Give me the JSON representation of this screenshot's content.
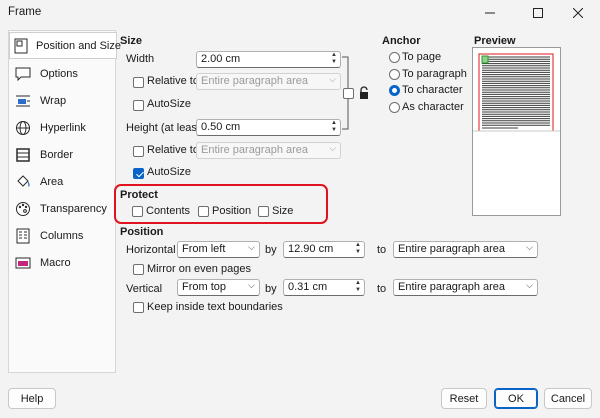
{
  "window": {
    "title": "Frame"
  },
  "sidebar": {
    "items": [
      {
        "label": "Position and Size",
        "icon": "position-size-icon",
        "active": true
      },
      {
        "label": "Options",
        "icon": "speech-bubble-icon"
      },
      {
        "label": "Wrap",
        "icon": "wrap-icon"
      },
      {
        "label": "Hyperlink",
        "icon": "globe-icon"
      },
      {
        "label": "Border",
        "icon": "border-icon"
      },
      {
        "label": "Area",
        "icon": "paint-bucket-icon"
      },
      {
        "label": "Transparency",
        "icon": "palette-icon"
      },
      {
        "label": "Columns",
        "icon": "columns-icon"
      },
      {
        "label": "Macro",
        "icon": "macro-icon"
      }
    ]
  },
  "size": {
    "heading": "Size",
    "width_label": "Width",
    "width_value": "2.00 cm",
    "relative_to_label": "Relative to",
    "relative_to_value": "Entire paragraph area",
    "autosize_label": "AutoSize",
    "height_label": "Height (at least)",
    "height_value": "0.50 cm",
    "relative_to2_label": "Relative to",
    "relative_to2_value": "Entire paragraph area",
    "autosize2_label": "AutoSize"
  },
  "anchor": {
    "heading": "Anchor",
    "options": [
      "To page",
      "To paragraph",
      "To character",
      "As character"
    ],
    "selected": "To character"
  },
  "preview": {
    "heading": "Preview"
  },
  "protect": {
    "heading": "Protect",
    "contents_label": "Contents",
    "position_label": "Position",
    "size_label": "Size"
  },
  "position": {
    "heading": "Position",
    "horizontal_label": "Horizontal",
    "horizontal_value": "From left",
    "by_label": "by",
    "horizontal_by": "12.90 cm",
    "to_label": "to",
    "horizontal_to": "Entire paragraph area",
    "mirror_label": "Mirror on even pages",
    "vertical_label": "Vertical",
    "vertical_value": "From top",
    "by2_label": "by",
    "vertical_by": "0.31 cm",
    "to2_label": "to",
    "vertical_to": "Entire paragraph area",
    "keep_inside_label": "Keep inside text boundaries"
  },
  "buttons": {
    "help": "Help",
    "reset": "Reset",
    "ok": "OK",
    "cancel": "Cancel"
  },
  "colors": {
    "accent": "#0a64c8",
    "highlight": "#e0141e"
  }
}
